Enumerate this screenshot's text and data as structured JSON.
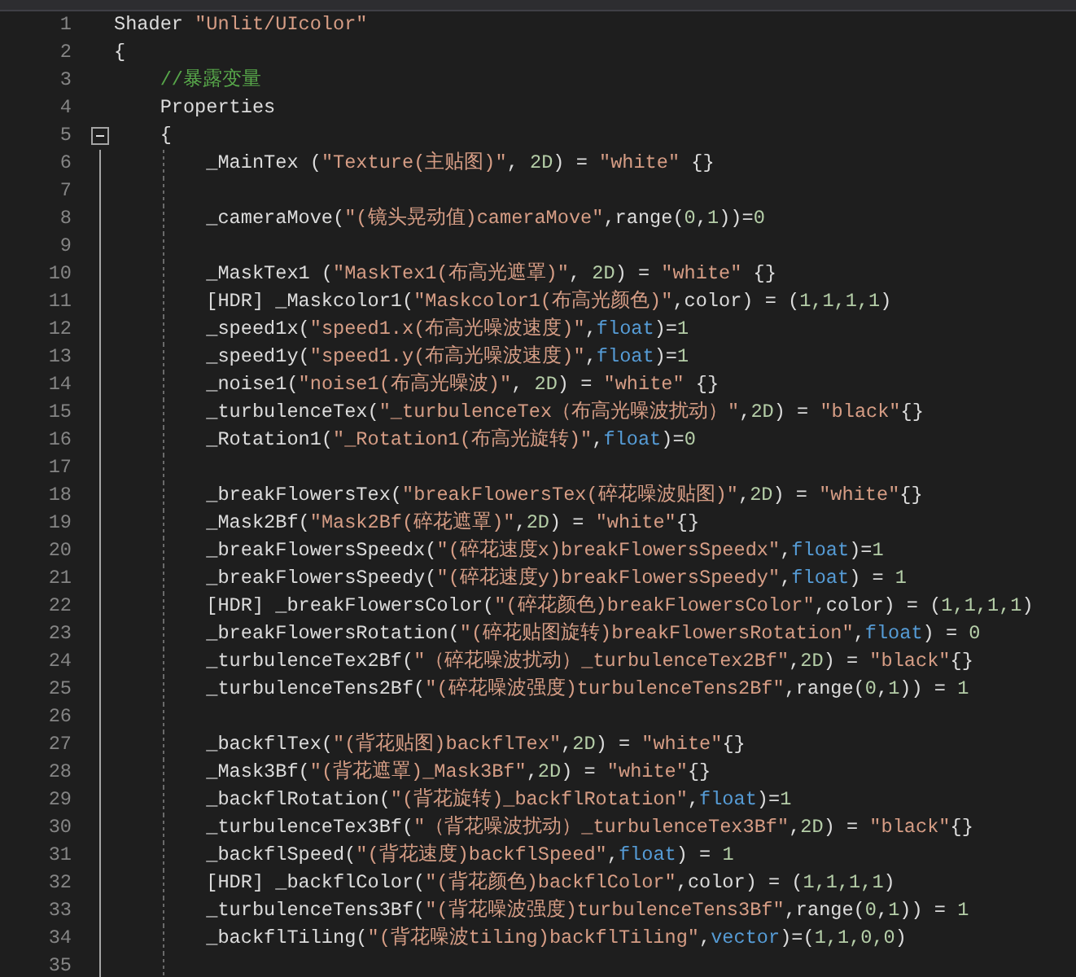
{
  "lines": [
    {
      "number": "1",
      "tokens": [
        {
          "kind": "plain",
          "text": "Shader "
        },
        {
          "kind": "string",
          "text": "\"Unlit/UIcolor\""
        }
      ]
    },
    {
      "number": "2",
      "tokens": [
        {
          "kind": "plain",
          "text": "{"
        }
      ]
    },
    {
      "number": "3",
      "tokens": [
        {
          "kind": "comment",
          "text": "    //暴露变量"
        }
      ]
    },
    {
      "number": "4",
      "tokens": [
        {
          "kind": "plain",
          "text": "    Properties"
        }
      ]
    },
    {
      "number": "5",
      "expanded": true,
      "tokens": [
        {
          "kind": "plain",
          "text": "    {"
        }
      ]
    },
    {
      "number": "6",
      "tokens": [
        {
          "kind": "plain",
          "text": "        _MainTex ("
        },
        {
          "kind": "string",
          "text": "\"Texture(主贴图)\""
        },
        {
          "kind": "plain",
          "text": ", "
        },
        {
          "kind": "number",
          "text": "2D"
        },
        {
          "kind": "plain",
          "text": ") = "
        },
        {
          "kind": "string",
          "text": "\"white\""
        },
        {
          "kind": "plain",
          "text": " {}"
        }
      ]
    },
    {
      "number": "7"
    },
    {
      "number": "8",
      "tokens": [
        {
          "kind": "plain",
          "text": "        _cameraMove("
        },
        {
          "kind": "string",
          "text": "\"(镜头晃动值)cameraMove\""
        },
        {
          "kind": "plain",
          "text": ",range("
        },
        {
          "kind": "number",
          "text": "0"
        },
        {
          "kind": "plain",
          "text": ","
        },
        {
          "kind": "number",
          "text": "1"
        },
        {
          "kind": "plain",
          "text": "))="
        },
        {
          "kind": "number",
          "text": "0"
        }
      ]
    },
    {
      "number": "9"
    },
    {
      "number": "10",
      "tokens": [
        {
          "kind": "plain",
          "text": "        _MaskTex1 ("
        },
        {
          "kind": "string",
          "text": "\"MaskTex1(布高光遮罩)\""
        },
        {
          "kind": "plain",
          "text": ", "
        },
        {
          "kind": "number",
          "text": "2D"
        },
        {
          "kind": "plain",
          "text": ") = "
        },
        {
          "kind": "string",
          "text": "\"white\""
        },
        {
          "kind": "plain",
          "text": " {}"
        }
      ]
    },
    {
      "number": "11",
      "tokens": [
        {
          "kind": "plain",
          "text": "        [HDR] _Maskcolor1("
        },
        {
          "kind": "string",
          "text": "\"Maskcolor1(布高光颜色)\""
        },
        {
          "kind": "plain",
          "text": ",color) = ("
        },
        {
          "kind": "number",
          "text": "1,1,1,1"
        },
        {
          "kind": "plain",
          "text": ")"
        }
      ]
    },
    {
      "number": "12",
      "tokens": [
        {
          "kind": "plain",
          "text": "        _speed1x("
        },
        {
          "kind": "string",
          "text": "\"speed1.x(布高光噪波速度)\""
        },
        {
          "kind": "plain",
          "text": ","
        },
        {
          "kind": "keyword",
          "text": "float"
        },
        {
          "kind": "plain",
          "text": ")="
        },
        {
          "kind": "number",
          "text": "1"
        }
      ]
    },
    {
      "number": "13",
      "tokens": [
        {
          "kind": "plain",
          "text": "        _speed1y("
        },
        {
          "kind": "string",
          "text": "\"speed1.y(布高光噪波速度)\""
        },
        {
          "kind": "plain",
          "text": ","
        },
        {
          "kind": "keyword",
          "text": "float"
        },
        {
          "kind": "plain",
          "text": ")="
        },
        {
          "kind": "number",
          "text": "1"
        }
      ]
    },
    {
      "number": "14",
      "tokens": [
        {
          "kind": "plain",
          "text": "        _noise1("
        },
        {
          "kind": "string",
          "text": "\"noise1(布高光噪波)\""
        },
        {
          "kind": "plain",
          "text": ", "
        },
        {
          "kind": "number",
          "text": "2D"
        },
        {
          "kind": "plain",
          "text": ") = "
        },
        {
          "kind": "string",
          "text": "\"white\""
        },
        {
          "kind": "plain",
          "text": " {}"
        }
      ]
    },
    {
      "number": "15",
      "tokens": [
        {
          "kind": "plain",
          "text": "        _turbulenceTex("
        },
        {
          "kind": "string",
          "text": "\"_turbulenceTex（布高光噪波扰动）\""
        },
        {
          "kind": "plain",
          "text": ","
        },
        {
          "kind": "number",
          "text": "2D"
        },
        {
          "kind": "plain",
          "text": ") = "
        },
        {
          "kind": "string",
          "text": "\"black\""
        },
        {
          "kind": "plain",
          "text": "{}"
        }
      ]
    },
    {
      "number": "16",
      "tokens": [
        {
          "kind": "plain",
          "text": "        _Rotation1("
        },
        {
          "kind": "string",
          "text": "\"_Rotation1(布高光旋转)\""
        },
        {
          "kind": "plain",
          "text": ","
        },
        {
          "kind": "keyword",
          "text": "float"
        },
        {
          "kind": "plain",
          "text": ")="
        },
        {
          "kind": "number",
          "text": "0"
        }
      ]
    },
    {
      "number": "17"
    },
    {
      "number": "18",
      "tokens": [
        {
          "kind": "plain",
          "text": "        _breakFlowersTex("
        },
        {
          "kind": "string",
          "text": "\"breakFlowersTex(碎花噪波贴图)\""
        },
        {
          "kind": "plain",
          "text": ","
        },
        {
          "kind": "number",
          "text": "2D"
        },
        {
          "kind": "plain",
          "text": ") = "
        },
        {
          "kind": "string",
          "text": "\"white\""
        },
        {
          "kind": "plain",
          "text": "{}"
        }
      ]
    },
    {
      "number": "19",
      "tokens": [
        {
          "kind": "plain",
          "text": "        _Mask2Bf("
        },
        {
          "kind": "string",
          "text": "\"Mask2Bf(碎花遮罩)\""
        },
        {
          "kind": "plain",
          "text": ","
        },
        {
          "kind": "number",
          "text": "2D"
        },
        {
          "kind": "plain",
          "text": ") = "
        },
        {
          "kind": "string",
          "text": "\"white\""
        },
        {
          "kind": "plain",
          "text": "{}"
        }
      ]
    },
    {
      "number": "20",
      "tokens": [
        {
          "kind": "plain",
          "text": "        _breakFlowersSpeedx("
        },
        {
          "kind": "string",
          "text": "\"(碎花速度x)breakFlowersSpeedx\""
        },
        {
          "kind": "plain",
          "text": ","
        },
        {
          "kind": "keyword",
          "text": "float"
        },
        {
          "kind": "plain",
          "text": ")="
        },
        {
          "kind": "number",
          "text": "1"
        }
      ]
    },
    {
      "number": "21",
      "tokens": [
        {
          "kind": "plain",
          "text": "        _breakFlowersSpeedy("
        },
        {
          "kind": "string",
          "text": "\"(碎花速度y)breakFlowersSpeedy\""
        },
        {
          "kind": "plain",
          "text": ","
        },
        {
          "kind": "keyword",
          "text": "float"
        },
        {
          "kind": "plain",
          "text": ") = "
        },
        {
          "kind": "number",
          "text": "1"
        }
      ]
    },
    {
      "number": "22",
      "tokens": [
        {
          "kind": "plain",
          "text": "        [HDR] _breakFlowersColor("
        },
        {
          "kind": "string",
          "text": "\"(碎花颜色)breakFlowersColor\""
        },
        {
          "kind": "plain",
          "text": ",color) = ("
        },
        {
          "kind": "number",
          "text": "1,1,1,1"
        },
        {
          "kind": "plain",
          "text": ")"
        }
      ]
    },
    {
      "number": "23",
      "tokens": [
        {
          "kind": "plain",
          "text": "        _breakFlowersRotation("
        },
        {
          "kind": "string",
          "text": "\"(碎花贴图旋转)breakFlowersRotation\""
        },
        {
          "kind": "plain",
          "text": ","
        },
        {
          "kind": "keyword",
          "text": "float"
        },
        {
          "kind": "plain",
          "text": ") = "
        },
        {
          "kind": "number",
          "text": "0"
        }
      ]
    },
    {
      "number": "24",
      "tokens": [
        {
          "kind": "plain",
          "text": "        _turbulenceTex2Bf("
        },
        {
          "kind": "string",
          "text": "\"（碎花噪波扰动）_turbulenceTex2Bf\""
        },
        {
          "kind": "plain",
          "text": ","
        },
        {
          "kind": "number",
          "text": "2D"
        },
        {
          "kind": "plain",
          "text": ") = "
        },
        {
          "kind": "string",
          "text": "\"black\""
        },
        {
          "kind": "plain",
          "text": "{}"
        }
      ]
    },
    {
      "number": "25",
      "tokens": [
        {
          "kind": "plain",
          "text": "        _turbulenceTens2Bf("
        },
        {
          "kind": "string",
          "text": "\"(碎花噪波强度)turbulenceTens2Bf\""
        },
        {
          "kind": "plain",
          "text": ",range("
        },
        {
          "kind": "number",
          "text": "0"
        },
        {
          "kind": "plain",
          "text": ","
        },
        {
          "kind": "number",
          "text": "1"
        },
        {
          "kind": "plain",
          "text": ")) = "
        },
        {
          "kind": "number",
          "text": "1"
        }
      ]
    },
    {
      "number": "26"
    },
    {
      "number": "27",
      "tokens": [
        {
          "kind": "plain",
          "text": "        _backflTex("
        },
        {
          "kind": "string",
          "text": "\"(背花贴图)backflTex\""
        },
        {
          "kind": "plain",
          "text": ","
        },
        {
          "kind": "number",
          "text": "2D"
        },
        {
          "kind": "plain",
          "text": ") = "
        },
        {
          "kind": "string",
          "text": "\"white\""
        },
        {
          "kind": "plain",
          "text": "{}"
        }
      ]
    },
    {
      "number": "28",
      "tokens": [
        {
          "kind": "plain",
          "text": "        _Mask3Bf("
        },
        {
          "kind": "string",
          "text": "\"(背花遮罩)_Mask3Bf\""
        },
        {
          "kind": "plain",
          "text": ","
        },
        {
          "kind": "number",
          "text": "2D"
        },
        {
          "kind": "plain",
          "text": ") = "
        },
        {
          "kind": "string",
          "text": "\"white\""
        },
        {
          "kind": "plain",
          "text": "{}"
        }
      ]
    },
    {
      "number": "29",
      "tokens": [
        {
          "kind": "plain",
          "text": "        _backflRotation("
        },
        {
          "kind": "string",
          "text": "\"(背花旋转)_backflRotation\""
        },
        {
          "kind": "plain",
          "text": ","
        },
        {
          "kind": "keyword",
          "text": "float"
        },
        {
          "kind": "plain",
          "text": ")="
        },
        {
          "kind": "number",
          "text": "1"
        }
      ]
    },
    {
      "number": "30",
      "tokens": [
        {
          "kind": "plain",
          "text": "        _turbulenceTex3Bf("
        },
        {
          "kind": "string",
          "text": "\"（背花噪波扰动）_turbulenceTex3Bf\""
        },
        {
          "kind": "plain",
          "text": ","
        },
        {
          "kind": "number",
          "text": "2D"
        },
        {
          "kind": "plain",
          "text": ") = "
        },
        {
          "kind": "string",
          "text": "\"black\""
        },
        {
          "kind": "plain",
          "text": "{}"
        }
      ]
    },
    {
      "number": "31",
      "tokens": [
        {
          "kind": "plain",
          "text": "        _backflSpeed("
        },
        {
          "kind": "string",
          "text": "\"(背花速度)backflSpeed\""
        },
        {
          "kind": "plain",
          "text": ","
        },
        {
          "kind": "keyword",
          "text": "float"
        },
        {
          "kind": "plain",
          "text": ") = "
        },
        {
          "kind": "number",
          "text": "1"
        }
      ]
    },
    {
      "number": "32",
      "tokens": [
        {
          "kind": "plain",
          "text": "        [HDR] _backflColor("
        },
        {
          "kind": "string",
          "text": "\"(背花颜色)backflColor\""
        },
        {
          "kind": "plain",
          "text": ",color) = ("
        },
        {
          "kind": "number",
          "text": "1,1,1,1"
        },
        {
          "kind": "plain",
          "text": ")"
        }
      ]
    },
    {
      "number": "33",
      "tokens": [
        {
          "kind": "plain",
          "text": "        _turbulenceTens3Bf("
        },
        {
          "kind": "string",
          "text": "\"(背花噪波强度)turbulenceTens3Bf\""
        },
        {
          "kind": "plain",
          "text": ",range("
        },
        {
          "kind": "number",
          "text": "0"
        },
        {
          "kind": "plain",
          "text": ","
        },
        {
          "kind": "number",
          "text": "1"
        },
        {
          "kind": "plain",
          "text": ")) = "
        },
        {
          "kind": "number",
          "text": "1"
        }
      ]
    },
    {
      "number": "34",
      "tokens": [
        {
          "kind": "plain",
          "text": "        _backflTiling("
        },
        {
          "kind": "string",
          "text": "\"(背花噪波tiling)backflTiling\""
        },
        {
          "kind": "plain",
          "text": ","
        },
        {
          "kind": "keyword",
          "text": "vector"
        },
        {
          "kind": "plain",
          "text": ")=("
        },
        {
          "kind": "number",
          "text": "1,1,0,0"
        },
        {
          "kind": "plain",
          "text": ")"
        }
      ]
    },
    {
      "number": "35"
    }
  ]
}
